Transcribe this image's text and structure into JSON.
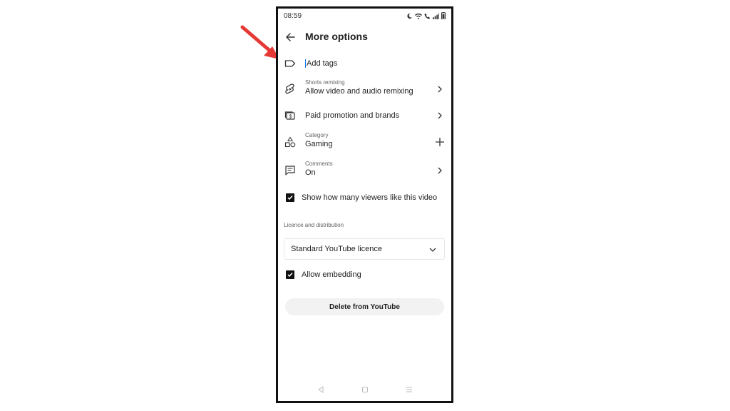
{
  "status_bar": {
    "time": "08:59"
  },
  "header": {
    "title": "More options"
  },
  "rows": {
    "tags": {
      "label": "Add tags"
    },
    "remix": {
      "sub": "Shorts remixing",
      "main": "Allow video and audio remixing"
    },
    "promo": {
      "main": "Paid promotion and brands"
    },
    "category": {
      "sub": "Category",
      "main": "Gaming"
    },
    "comments": {
      "sub": "Comments",
      "main": "On"
    }
  },
  "checkboxes": {
    "likes": {
      "label": "Show how many viewers like this video",
      "checked": true
    },
    "embed": {
      "label": "Allow embedding",
      "checked": true
    }
  },
  "licence": {
    "section_label": "Licence and distribution",
    "selected": "Standard YouTube licence"
  },
  "delete_button": {
    "label": "Delete from YouTube"
  },
  "colors": {
    "arrow": "#e53935",
    "accent": "#1a73e8",
    "checkbox": "#111111"
  }
}
